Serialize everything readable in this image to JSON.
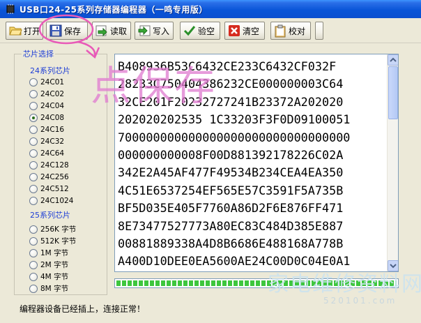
{
  "window": {
    "title": "USB口24-25系列存储器编程器（一鸣专用版）",
    "icon": "chip-icon"
  },
  "toolbar": {
    "buttons": [
      {
        "label": "打开",
        "icon": "folder-open-icon"
      },
      {
        "label": "保存",
        "icon": "floppy-save-icon"
      },
      {
        "label": "读取",
        "icon": "read-arrow-icon"
      },
      {
        "label": "写入",
        "icon": "write-arrow-icon"
      },
      {
        "label": "验空",
        "icon": "checkmark-icon"
      },
      {
        "label": "清空",
        "icon": "red-x-icon"
      },
      {
        "label": "校对",
        "icon": "clipboard-icon"
      }
    ]
  },
  "chip_panel": {
    "legend": "芯片选择",
    "series24_label": "24系列芯片",
    "series24": [
      "24C01",
      "24C02",
      "24C04",
      "24C08",
      "24C16",
      "24C32",
      "24C64",
      "24C128",
      "24C256",
      "24C512",
      "24C1024"
    ],
    "series24_selected": "24C08",
    "series25_label": "25系列芯片",
    "series25": [
      "256K 字节",
      "512K 字节",
      "1M 字节",
      "2M 字节",
      "4M 字节",
      "8M 字节"
    ]
  },
  "hex_view": {
    "lines": [
      "B408936B53C6432CE233C6432CF032F",
      "28233C750404386232CE000000003C64",
      "32CE201F20232727241B23372A202020",
      "202020202535 1C33203F3F0D09100051",
      "700000000000000000000000000000000",
      "000000000008F00D881392178226C02A",
      "342E2A45AF477F49534B234CEA4EA350",
      "4C51E6537254EF565E57C3591F5A735B",
      "BF5D035E405F7760A86D2F6E876FF471",
      "8E73477527773A80EC83C484D385E887",
      "00881889338A4D8B6686E488168A778B",
      "A400D10DEE0EA5600AE24C00D0C04E0A1"
    ]
  },
  "progress": {
    "value_percent": 100
  },
  "status": {
    "text": "编程器设备已经插上，连接正常！"
  },
  "annotation": {
    "text": "点保存"
  },
  "watermark": {
    "main": "家电维修资料网",
    "sub": "520101.com"
  },
  "colors": {
    "titlebar": "#0a55d8",
    "group_label": "#1f3fd6",
    "progress_green": "#3ec63e",
    "annotation_pink": "#e07ad0"
  }
}
